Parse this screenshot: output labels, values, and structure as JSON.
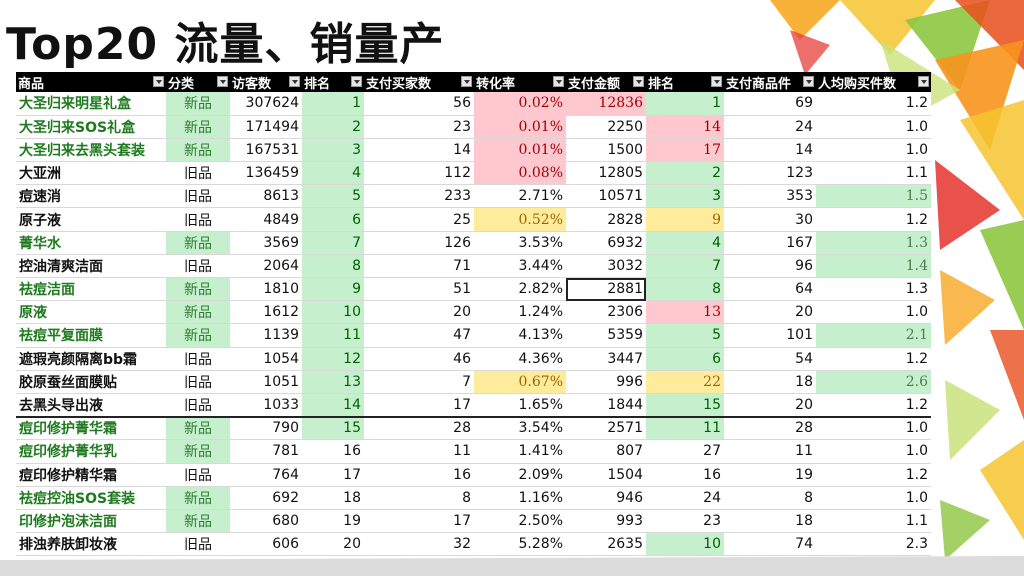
{
  "slide": {
    "title": "Top20 流量、销量产"
  },
  "columns": [
    "商品",
    "分类",
    "访客数",
    "排名",
    "支付买家数",
    "转化率",
    "支付金额",
    "排名",
    "支付商品件",
    "人均购买件数"
  ],
  "rows": [
    [
      "大圣归来明星礼盒",
      "新品",
      "307624",
      "1",
      "56",
      "0.02%",
      "12836",
      "1",
      "69",
      "1.2"
    ],
    [
      "大圣归来SOS礼盒",
      "新品",
      "171494",
      "2",
      "23",
      "0.01%",
      "2250",
      "14",
      "24",
      "1.0"
    ],
    [
      "大圣归来去黑头套装",
      "新品",
      "167531",
      "3",
      "14",
      "0.01%",
      "1500",
      "17",
      "14",
      "1.0"
    ],
    [
      "大亚洲",
      "旧品",
      "136459",
      "4",
      "112",
      "0.08%",
      "12805",
      "2",
      "123",
      "1.1"
    ],
    [
      "痘速消",
      "旧品",
      "8613",
      "5",
      "233",
      "2.71%",
      "10571",
      "3",
      "353",
      "1.5"
    ],
    [
      "原子液",
      "旧品",
      "4849",
      "6",
      "25",
      "0.52%",
      "2828",
      "9",
      "30",
      "1.2"
    ],
    [
      "菁华水",
      "新品",
      "3569",
      "7",
      "126",
      "3.53%",
      "6932",
      "4",
      "167",
      "1.3"
    ],
    [
      "控油清爽洁面",
      "旧品",
      "2064",
      "8",
      "71",
      "3.44%",
      "3032",
      "7",
      "96",
      "1.4"
    ],
    [
      "祛痘洁面",
      "新品",
      "1810",
      "9",
      "51",
      "2.82%",
      "2881",
      "8",
      "64",
      "1.3"
    ],
    [
      "原液",
      "新品",
      "1612",
      "10",
      "20",
      "1.24%",
      "2306",
      "13",
      "20",
      "1.0"
    ],
    [
      "祛痘平复面膜",
      "新品",
      "1139",
      "11",
      "47",
      "4.13%",
      "5359",
      "5",
      "101",
      "2.1"
    ],
    [
      "遮瑕亮颜隔离bb霜",
      "旧品",
      "1054",
      "12",
      "46",
      "4.36%",
      "3447",
      "6",
      "54",
      "1.2"
    ],
    [
      "胶原蚕丝面膜贴",
      "旧品",
      "1051",
      "13",
      "7",
      "0.67%",
      "996",
      "22",
      "18",
      "2.6"
    ],
    [
      "去黑头导出液",
      "旧品",
      "1033",
      "14",
      "17",
      "1.65%",
      "1844",
      "15",
      "20",
      "1.2"
    ],
    [
      "痘印修护菁华霜",
      "新品",
      "790",
      "15",
      "28",
      "3.54%",
      "2571",
      "11",
      "28",
      "1.0"
    ],
    [
      "痘印修护菁华乳",
      "新品",
      "781",
      "16",
      "11",
      "1.41%",
      "807",
      "27",
      "11",
      "1.0"
    ],
    [
      "痘印修护精华霜",
      "旧品",
      "764",
      "17",
      "16",
      "2.09%",
      "1504",
      "16",
      "19",
      "1.2"
    ],
    [
      "祛痘控油SOS套装",
      "新品",
      "692",
      "18",
      "8",
      "1.16%",
      "946",
      "24",
      "8",
      "1.0"
    ],
    [
      "印修护泡沫洁面",
      "新品",
      "680",
      "19",
      "17",
      "2.50%",
      "993",
      "23",
      "18",
      "1.1"
    ],
    [
      "排浊养肤卸妆液",
      "旧品",
      "606",
      "20",
      "32",
      "5.28%",
      "2635",
      "10",
      "74",
      "2.3"
    ]
  ],
  "highlights": {
    "visitor_rank_green_rows": 15,
    "conversion_red_rows": [
      0,
      1,
      2,
      3
    ],
    "conversion_yellow_rows": [
      5,
      12
    ],
    "amount_red_rows": [
      0
    ],
    "pay_rank_green_rows": [
      0,
      3,
      4,
      6,
      7,
      8,
      10,
      11,
      13,
      14,
      19
    ],
    "pay_rank_red_rows": [
      1,
      2,
      9
    ],
    "pay_rank_yellow_rows": [
      5,
      12
    ],
    "per_buyer_green_rows": [
      4,
      6,
      7,
      10,
      12
    ],
    "selected_cell_row": 8
  },
  "colors": {
    "header_bg": "#000000",
    "good": "#c6efce",
    "bad": "#ffc7ce",
    "neutral": "#ffeb9c",
    "new_item_text": "#1f7a1f"
  }
}
